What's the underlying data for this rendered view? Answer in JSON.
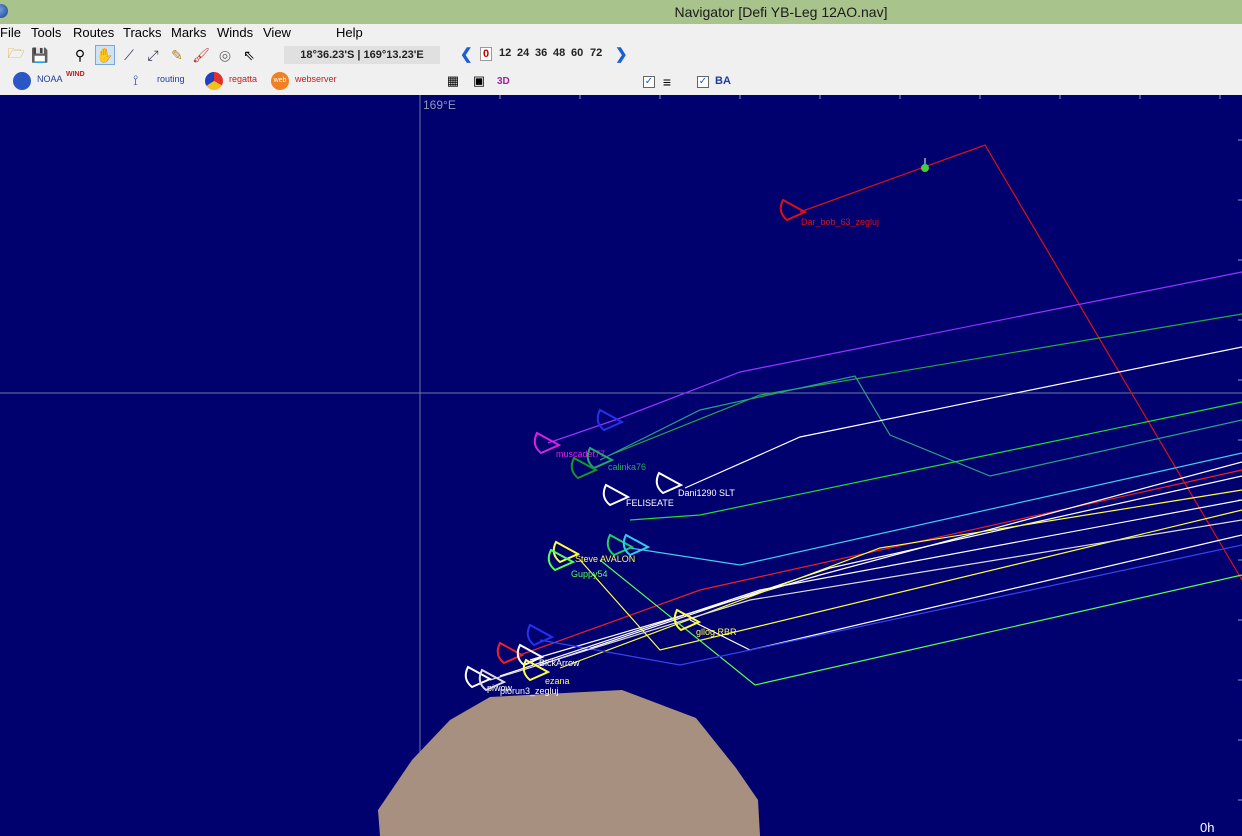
{
  "window": {
    "title": "Navigator [Defi YB-Leg 12AO.nav]"
  },
  "menu": [
    "File",
    "Tools",
    "Routes",
    "Tracks",
    "Marks",
    "Winds",
    "View",
    "Help"
  ],
  "toolbar": {
    "coordinates": "18°36.23'S | 169°13.23'E",
    "hours": [
      "0",
      "12",
      "24",
      "36",
      "48",
      "60",
      "72"
    ],
    "selected_hour": "0"
  },
  "toolbar2": {
    "noaa": "NOAA",
    "wind": "WIND",
    "routing": "routing",
    "regatta": "regatta",
    "webserver": "webserver",
    "three_d": "3D",
    "ba": "BA"
  },
  "map": {
    "longitude_label": "169°E",
    "time_label": "0h",
    "colors": {
      "sea": "#00006e",
      "land": "#a89080",
      "grid": "#6a7a9a"
    },
    "boats": [
      {
        "name": "Dar_bob_63_zegluj",
        "color": "#dd1111"
      },
      {
        "name": "muscadet77",
        "color": "#dd22dd"
      },
      {
        "name": "calinka76",
        "color": "#22aa66"
      },
      {
        "name": "Dani1290 SLT",
        "color": "#ffffff"
      },
      {
        "name": "FELISEATE",
        "color": "#ffffff"
      },
      {
        "name": "Steve AVALON",
        "color": "#ffff44"
      },
      {
        "name": "Guppy54",
        "color": "#55ff55"
      },
      {
        "name": "gllog RBR",
        "color": "#ffff44"
      },
      {
        "name": "BlckArrow",
        "color": "#ffffff"
      },
      {
        "name": "ezana",
        "color": "#ffff44"
      },
      {
        "name": "piwow",
        "color": "#ffffff"
      },
      {
        "name": "piorun3_zegluj",
        "color": "#ffffff"
      }
    ]
  }
}
